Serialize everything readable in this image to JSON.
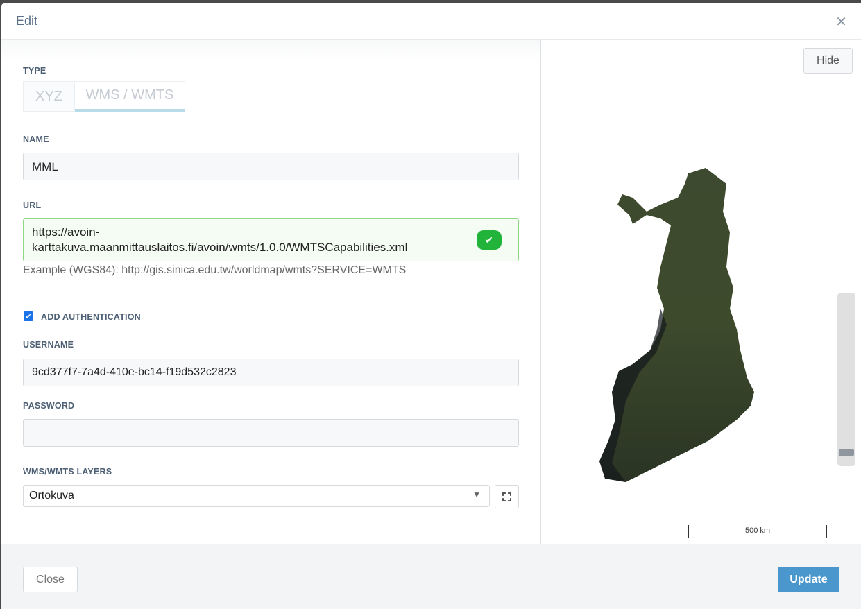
{
  "dialog": {
    "title": "Edit",
    "close_icon": "close-icon"
  },
  "type": {
    "label": "TYPE",
    "tabs": [
      {
        "label": "XYZ",
        "active": false
      },
      {
        "label": "WMS / WMTS",
        "active": true
      }
    ]
  },
  "name": {
    "label": "NAME",
    "value": "MML"
  },
  "url": {
    "label": "URL",
    "value_line1": "https://avoin-",
    "value_line2": "karttakuva.maanmittauslaitos.fi/avoin/wmts/1.0.0/WMTSCapabilities.xml",
    "valid": true,
    "hint": "Example (WGS84): http://gis.sinica.edu.tw/worldmap/wmts?SERVICE=WMTS"
  },
  "auth": {
    "label": "ADD AUTHENTICATION",
    "checked": true
  },
  "username": {
    "label": "USERNAME",
    "value": "9cd377f7-7a4d-410e-bc14-f19d532c2823"
  },
  "password": {
    "label": "PASSWORD",
    "value": ""
  },
  "layers": {
    "label": "WMS/WMTS LAYERS",
    "selected": "Ortokuva"
  },
  "preview": {
    "hide_label": "Hide",
    "scale_label": "500 km",
    "zoom_level": 0.05
  },
  "footer": {
    "close_label": "Close",
    "update_label": "Update"
  },
  "colors": {
    "accent": "#4a97cd",
    "valid": "#22b33a"
  }
}
